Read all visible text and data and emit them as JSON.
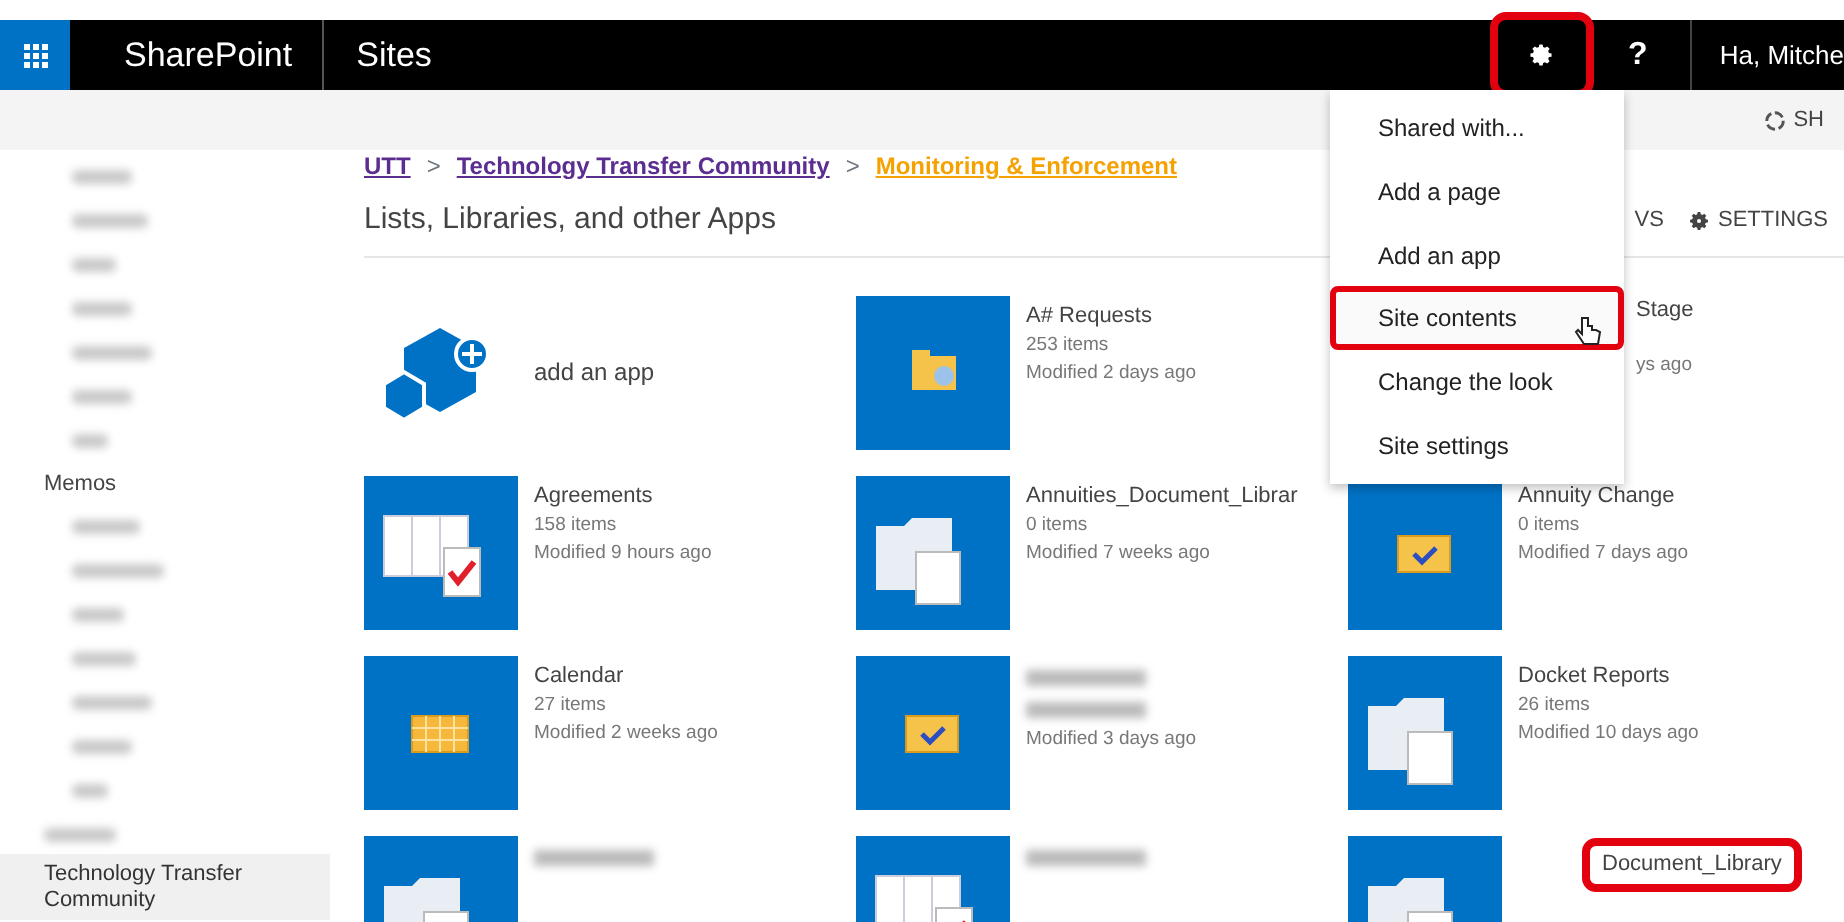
{
  "suite_bar": {
    "brand": "SharePoint",
    "section": "Sites",
    "settings_highlighted": true,
    "help": "?",
    "user": "Ha, Mitche"
  },
  "command_bar": {
    "share": "SH"
  },
  "sidebar": {
    "items": [
      {
        "kind": "blurred"
      },
      {
        "kind": "blurred"
      },
      {
        "kind": "blurred"
      },
      {
        "kind": "blurred"
      },
      {
        "kind": "blurred"
      },
      {
        "kind": "blurred"
      },
      {
        "kind": "blurred"
      },
      {
        "kind": "label",
        "label": "Memos"
      },
      {
        "kind": "blurred"
      },
      {
        "kind": "blurred"
      },
      {
        "kind": "blurred"
      },
      {
        "kind": "blurred"
      },
      {
        "kind": "blurred"
      },
      {
        "kind": "blurred"
      },
      {
        "kind": "blurred"
      },
      {
        "kind": "blurred"
      },
      {
        "kind": "label",
        "label": "Technology Transfer Community",
        "selected": true
      }
    ]
  },
  "breadcrumb": [
    {
      "label": "UTT",
      "current": false
    },
    {
      "label": "Technology Transfer Community",
      "current": false
    },
    {
      "label": "Monitoring & Enforcement",
      "current": true
    }
  ],
  "breadcrumb_separator": ">",
  "heading": "Lists, Libraries, and other Apps",
  "toolbar": [
    {
      "label": "VS",
      "kind": "text"
    },
    {
      "label": "SETTINGS",
      "kind": "settings"
    }
  ],
  "tiles": [
    {
      "kind": "add",
      "title": "add an app"
    },
    {
      "kind": "library",
      "title": "A# Requests",
      "count": "253 items",
      "modified": "Modified 2 days ago"
    },
    {
      "kind": "partial",
      "title": "Stage",
      "modified": "ys ago"
    },
    {
      "kind": "list",
      "title": "Agreements",
      "count": "158 items",
      "modified": "Modified 9 hours ago"
    },
    {
      "kind": "document",
      "title": "Annuities_Document_Librar",
      "count": "0 items",
      "modified": "Modified 7 weeks ago"
    },
    {
      "kind": "tasks",
      "title": "Annuity Change",
      "count": "0 items",
      "modified": "Modified 7 days ago"
    },
    {
      "kind": "calendar",
      "title": "Calendar",
      "count": "27 items",
      "modified": "Modified 2 weeks ago"
    },
    {
      "kind": "tasks",
      "blurred": true,
      "modified": "Modified 3 days ago"
    },
    {
      "kind": "document",
      "title": "Docket Reports",
      "count": "26 items",
      "modified": "Modified 10 days ago"
    },
    {
      "kind": "document",
      "blurred": true
    },
    {
      "kind": "list",
      "blurred": true
    },
    {
      "kind": "document",
      "title": "Document_Library",
      "highlighted": true
    }
  ],
  "settings_menu": {
    "open": true,
    "items": [
      {
        "label": "Shared with...",
        "highlighted": false
      },
      {
        "label": "Add a page",
        "highlighted": false
      },
      {
        "label": "Add an app",
        "highlighted": false
      },
      {
        "label": "Site contents",
        "highlighted": true
      },
      {
        "label": "Change the look",
        "highlighted": false
      },
      {
        "label": "Site settings",
        "highlighted": false
      }
    ]
  }
}
